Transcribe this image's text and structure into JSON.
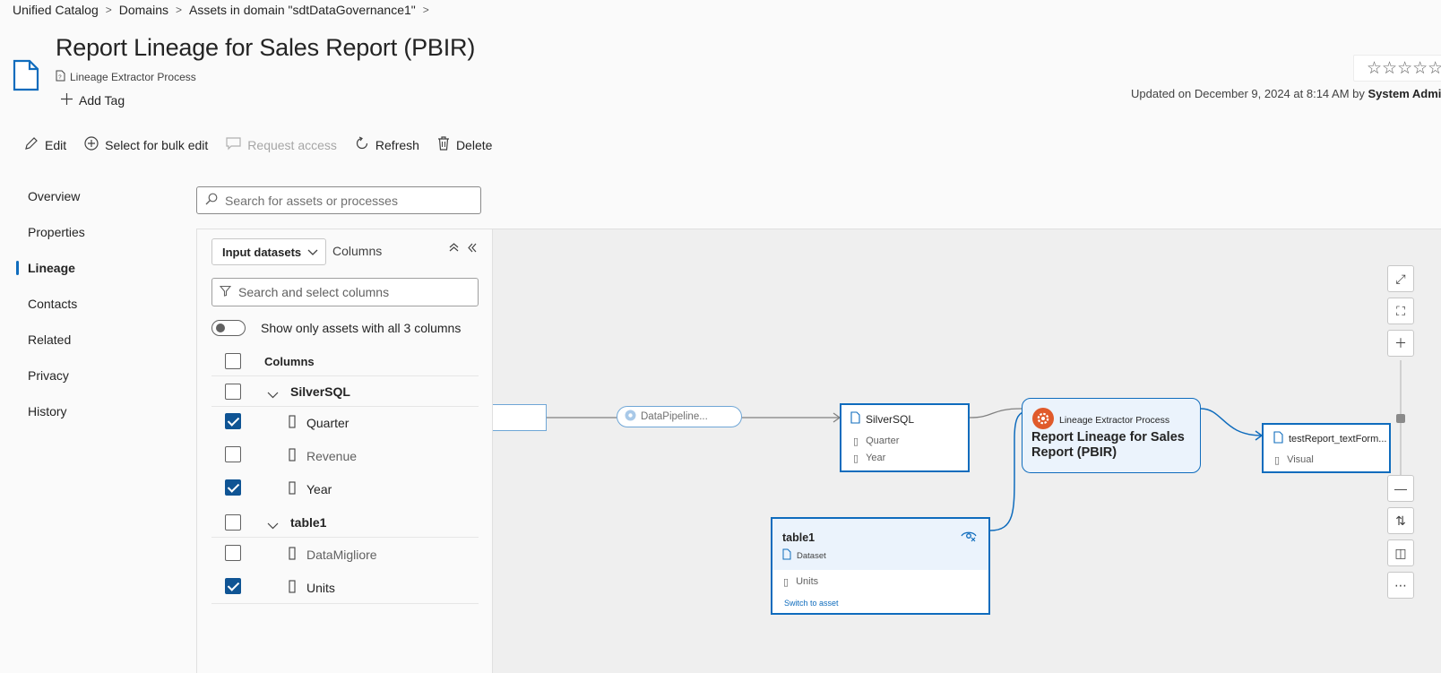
{
  "breadcrumb": {
    "items": [
      "Unified Catalog",
      "Domains",
      "Assets in domain \"sdtDataGovernance1\""
    ]
  },
  "header": {
    "title": "Report Lineage for Sales Report (PBIR)",
    "subtitle": "Lineage Extractor Process",
    "add_tag": "Add Tag",
    "rating_stars": "☆☆☆☆☆",
    "updated_prefix": "Updated on December 9, 2024 at 8:14 AM by ",
    "updated_by": "System Admin"
  },
  "toolbar": {
    "edit": "Edit",
    "bulk_edit": "Select for bulk edit",
    "request_access": "Request access",
    "refresh": "Refresh",
    "delete": "Delete"
  },
  "sidenav": {
    "items": [
      "Overview",
      "Properties",
      "Lineage",
      "Contacts",
      "Related",
      "Privacy",
      "History"
    ],
    "active": "Lineage"
  },
  "search": {
    "placeholder": "Search for assets or processes"
  },
  "panel": {
    "dropdown_value": "Input datasets",
    "columns_label": "Columns",
    "column_search_placeholder": "Search and select columns",
    "toggle_label": "Show only assets with all 3 columns",
    "toggle_on": false,
    "header": "Columns",
    "groups": [
      {
        "name": "SilverSQL",
        "columns": [
          {
            "name": "Quarter",
            "checked": true
          },
          {
            "name": "Revenue",
            "checked": false
          },
          {
            "name": "Year",
            "checked": true
          }
        ]
      },
      {
        "name": "table1",
        "columns": [
          {
            "name": "DataMigliore",
            "checked": false
          },
          {
            "name": "Units",
            "checked": true
          }
        ]
      }
    ]
  },
  "graph": {
    "pipeline_label": "DataPipeline...",
    "silversql": {
      "title": "SilverSQL",
      "cols": [
        "Quarter",
        "Year"
      ]
    },
    "process": {
      "type": "Lineage Extractor Process",
      "title": "Report Lineage for Sales Report (PBIR)"
    },
    "output": {
      "title": "testReport_textForm...",
      "cols": [
        "Visual"
      ]
    },
    "table1": {
      "title": "table1",
      "type": "Dataset",
      "cols": [
        "Units"
      ],
      "link": "Switch to asset"
    }
  },
  "colors": {
    "accent": "#0f6cbd",
    "checked": "#0f5494",
    "process_icon": "#e05a2b"
  }
}
